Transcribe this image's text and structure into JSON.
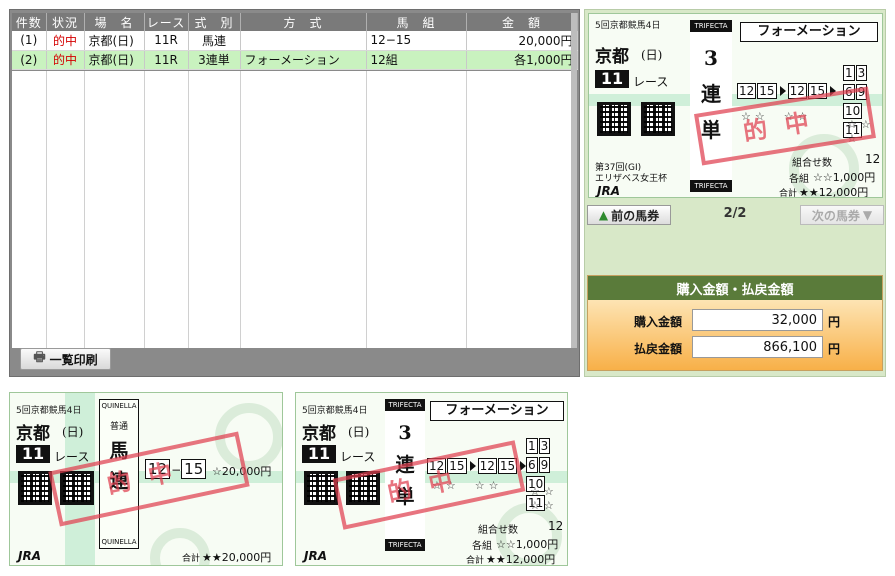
{
  "table": {
    "headers": [
      "件数",
      "状況",
      "場　名",
      "レース",
      "式　別",
      "方　式",
      "馬　組",
      "金　額"
    ],
    "rows": [
      {
        "count": "(1)",
        "status": "的中",
        "venue": "京都(日)",
        "race": "11R",
        "bet_type": "馬連",
        "method": "",
        "combo": "12−15",
        "amount": "20,000円"
      },
      {
        "count": "(2)",
        "status": "的中",
        "venue": "京都(日)",
        "race": "11R",
        "bet_type": "3連単",
        "method": "フォーメーション",
        "combo": "12組",
        "amount": "各1,000円"
      }
    ],
    "print_button": "一覧印刷",
    "print_icon": "printer-icon"
  },
  "nav": {
    "prev_label": "前の馬券",
    "next_label": "次の馬券",
    "page": "2/2",
    "prev_icon": "arrow-up-icon",
    "next_icon": "arrow-down-icon"
  },
  "payment": {
    "header": "購入金額・払戻金額",
    "purchase_label": "購入金額",
    "purchase_value": "32,000",
    "payout_label": "払戻金額",
    "payout_value": "866,100",
    "unit": "円"
  },
  "ticket_trifecta": {
    "meet": "5回京都競馬4日",
    "venue": "京都",
    "day": "(日)",
    "race_no": "11",
    "race_label": "レース",
    "bet_en": "TRIFECTA",
    "bet_digit": "3",
    "bet_chars": [
      "連",
      "単"
    ],
    "formation": "フォーメーション",
    "col1": [
      "12",
      "15"
    ],
    "col2": [
      "12",
      "15"
    ],
    "col3": [
      "1",
      "3",
      "6",
      "9",
      "10",
      "11"
    ],
    "combos_label": "組合せ数",
    "combos": "12",
    "each_label": "各組",
    "each_amount": "☆☆1,000円",
    "total_label": "合計",
    "total_amount": "★★12,000円",
    "race_name_1": "第37回(GI)",
    "race_name_2": "エリザベス女王杯",
    "brand": "JRA",
    "stamp": "的中"
  },
  "ticket_quinella": {
    "meet": "5回京都競馬4日",
    "venue": "京都",
    "day": "(日)",
    "race_no": "11",
    "race_label": "レース",
    "bet_en": "QUINELLA",
    "bet_sub": "普通",
    "bet_chars": [
      "馬",
      "連"
    ],
    "combo_a": "12",
    "combo_b": "15",
    "amount": "☆20,000円",
    "total_label": "合計",
    "total_amount": "★★20,000円",
    "brand": "JRA",
    "stamp": "的中"
  },
  "colors": {
    "hit": "#d40000",
    "selected_row": "#c9f2bf",
    "stamp": "#e04050",
    "pay_header": "#5a7b3a"
  }
}
